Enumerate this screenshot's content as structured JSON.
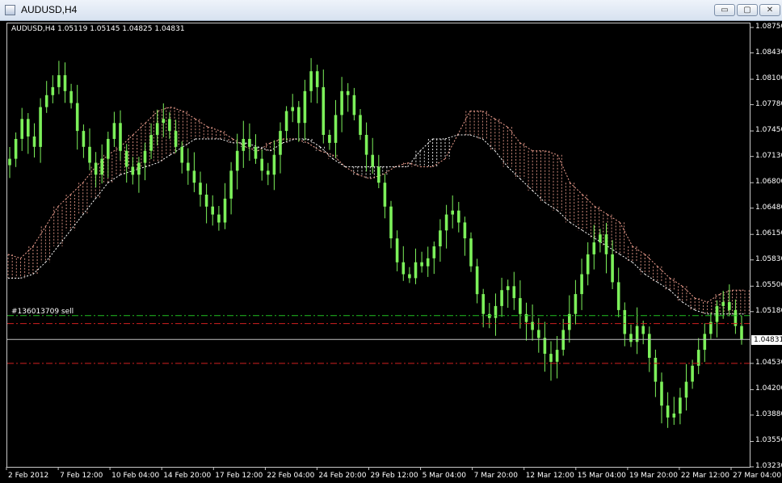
{
  "window": {
    "title": "AUDUSD,H4",
    "buttons": {
      "minimize": "▭",
      "maximize": "▢",
      "close": "✕"
    }
  },
  "info_text": "AUDUSD,H4  1.05119 1.05145 1.04825 1.04831",
  "order_label": "#136013709 sell",
  "current_price": "1.04831",
  "colors": {
    "background": "#000000",
    "candles": "#7cf05a",
    "cloud_bear": "#f0a090",
    "cloud_bull": "#ffffff",
    "order_line": "#22c022",
    "stop_line": "#d02020",
    "price_line": "#c0c0c0"
  },
  "chart_data": {
    "type": "candlestick",
    "symbol": "AUDUSD",
    "timeframe": "H4",
    "ylim": [
      1.0323,
      1.0875
    ],
    "price_ticks": [
      "1.08750",
      "1.08430",
      "1.08100",
      "1.07780",
      "1.07450",
      "1.07130",
      "1.06800",
      "1.06480",
      "1.06150",
      "1.05830",
      "1.05500",
      "1.05180",
      "1.04530",
      "1.04200",
      "1.03880",
      "1.03550",
      "1.03230"
    ],
    "time_ticks": [
      "2 Feb 2012",
      "7 Feb 12:00",
      "10 Feb 04:00",
      "14 Feb 20:00",
      "17 Feb 12:00",
      "22 Feb 04:00",
      "24 Feb 20:00",
      "29 Feb 12:00",
      "5 Mar 04:00",
      "7 Mar 20:00",
      "12 Mar 12:00",
      "15 Mar 04:00",
      "19 Mar 20:00",
      "22 Mar 12:00",
      "27 Mar 04:00"
    ],
    "close_series": [
      1.071,
      1.0735,
      1.076,
      1.0738,
      1.0725,
      1.0775,
      1.079,
      1.08,
      1.0815,
      1.0795,
      1.078,
      1.0745,
      1.0725,
      1.0705,
      1.069,
      1.071,
      1.0735,
      1.0755,
      1.072,
      1.07,
      1.069,
      1.0705,
      1.072,
      1.074,
      1.0755,
      1.076,
      1.0745,
      1.0725,
      1.0705,
      1.0695,
      1.068,
      1.0665,
      1.065,
      1.064,
      1.063,
      1.066,
      1.0695,
      1.072,
      1.0735,
      1.0725,
      1.071,
      1.0695,
      1.069,
      1.0715,
      1.0745,
      1.077,
      1.0775,
      1.0755,
      1.0795,
      1.082,
      1.08,
      1.074,
      1.073,
      1.0765,
      1.0795,
      1.079,
      1.0765,
      1.074,
      1.0715,
      1.07,
      1.068,
      1.065,
      1.061,
      1.058,
      1.0565,
      1.056,
      1.058,
      1.0575,
      1.0585,
      1.06,
      1.062,
      1.064,
      1.0645,
      1.063,
      1.061,
      1.0575,
      1.054,
      1.0515,
      1.051,
      1.0525,
      1.0545,
      1.055,
      1.0535,
      1.0515,
      1.0505,
      1.0495,
      1.0485,
      1.0465,
      1.0455,
      1.047,
      1.0495,
      1.0515,
      1.054,
      1.0565,
      1.059,
      1.0605,
      1.0615,
      1.059,
      1.0555,
      1.052,
      1.049,
      1.048,
      1.05,
      1.049,
      1.046,
      1.043,
      1.04,
      1.0385,
      1.039,
      1.041,
      1.043,
      1.045,
      1.047,
      1.049,
      1.0505,
      1.0525,
      1.053,
      1.052,
      1.05,
      1.0483
    ],
    "cloud": {
      "span_a": [
        1.059,
        1.0585,
        1.06,
        1.0625,
        1.065,
        1.0665,
        1.068,
        1.07,
        1.0715,
        1.0725,
        1.074,
        1.0755,
        1.077,
        1.0775,
        1.077,
        1.076,
        1.075,
        1.0745,
        1.0735,
        1.0725,
        1.072,
        1.073,
        1.0735,
        1.0735,
        1.073,
        1.072,
        1.0715,
        1.07,
        1.069,
        1.0685,
        1.069,
        1.07,
        1.0705,
        1.07,
        1.07,
        1.071,
        1.074,
        1.077,
        1.077,
        1.076,
        1.075,
        1.073,
        1.072,
        1.072,
        1.0715,
        1.068,
        1.0665,
        1.065,
        1.064,
        1.063,
        1.06,
        1.059,
        1.0575,
        1.056,
        1.055,
        1.0535,
        1.053,
        1.054,
        1.0545,
        1.0545
      ],
      "span_b": [
        1.056,
        1.056,
        1.0565,
        1.058,
        1.06,
        1.062,
        1.064,
        1.066,
        1.068,
        1.069,
        1.0695,
        1.07,
        1.0705,
        1.0715,
        1.0725,
        1.0735,
        1.0735,
        1.0735,
        1.073,
        1.073,
        1.0725,
        1.072,
        1.073,
        1.0735,
        1.0735,
        1.0725,
        1.071,
        1.07,
        1.07,
        1.07,
        1.07,
        1.07,
        1.07,
        1.072,
        1.0735,
        1.0735,
        1.074,
        1.074,
        1.0735,
        1.072,
        1.07,
        1.0685,
        1.067,
        1.0655,
        1.0645,
        1.063,
        1.062,
        1.061,
        1.06,
        1.059,
        1.058,
        1.0565,
        1.0555,
        1.0545,
        1.053,
        1.052,
        1.0515,
        1.0515,
        1.0515,
        1.0515
      ]
    },
    "levels": {
      "order_open": 1.0513,
      "stop_loss": 1.0503,
      "take_profit": 1.0453,
      "current_price": 1.04831
    }
  }
}
